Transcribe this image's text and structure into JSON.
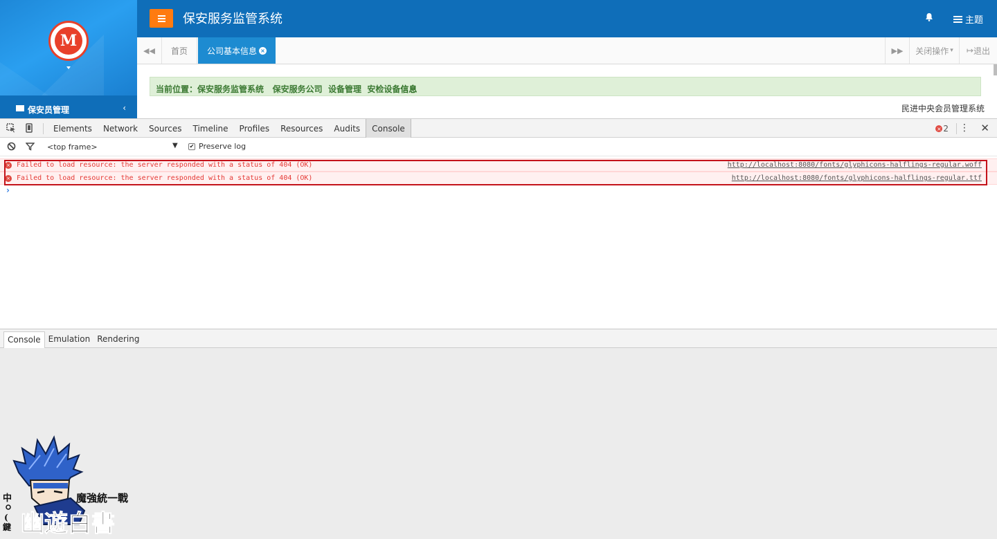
{
  "app": {
    "title": "保安服务监管系统",
    "logo_glyph": "M",
    "sidebar_menu": "保安员管理",
    "sidebar_arrow": "‹",
    "notifications_icon": "bell-icon",
    "theme_label": "主题",
    "tabs": {
      "prev": "◀◀",
      "home": "首页",
      "active": "公司基本信息",
      "active_close": "×",
      "next": "▶▶",
      "close_ops": "关闭操作",
      "close_ops_caret": "▾",
      "logout": "退出",
      "logout_icon": "↦"
    },
    "breadcrumb": {
      "label": "当前位置：",
      "items": [
        "保安服务监管系统",
        "保安服务公司",
        "设备管理",
        "安检设备"
      ],
      "last": "信息"
    },
    "footer_note": "民进中央会员管理系统",
    "colors": {
      "topbar": "#0f6eb9",
      "menu_button": "#ff7b10",
      "active_tab": "#1d8bd1",
      "breadcrumb_bg": "#dff0d8"
    }
  },
  "devtools": {
    "tabs": [
      "Elements",
      "Network",
      "Sources",
      "Timeline",
      "Profiles",
      "Resources",
      "Audits",
      "Console"
    ],
    "active_tab": "Console",
    "error_count": "2",
    "error_icon": "×",
    "menu_icon": "⋮",
    "close_icon": "✕",
    "frame": "<top frame>",
    "frame_caret": "▼",
    "preserve_log": "Preserve log",
    "preserve_log_checked": "✔",
    "messages": [
      {
        "text": "Failed to load resource: the server responded with a status of 404 (OK)",
        "source": "http://localhost:8080/fonts/glyphicons-halflings-regular.woff"
      },
      {
        "text": "Failed to load resource: the server responded with a status of 404 (OK)",
        "source": "http://localhost:8080/fonts/glyphicons-halflings-regular.ttf"
      }
    ],
    "prompt": "›",
    "drawer_tabs": [
      "Console",
      "Emulation",
      "Rendering"
    ]
  },
  "watermark": {
    "side_text": "中○鍵",
    "title_small": "魔強統一戰",
    "title_big": "幽遊白書"
  }
}
